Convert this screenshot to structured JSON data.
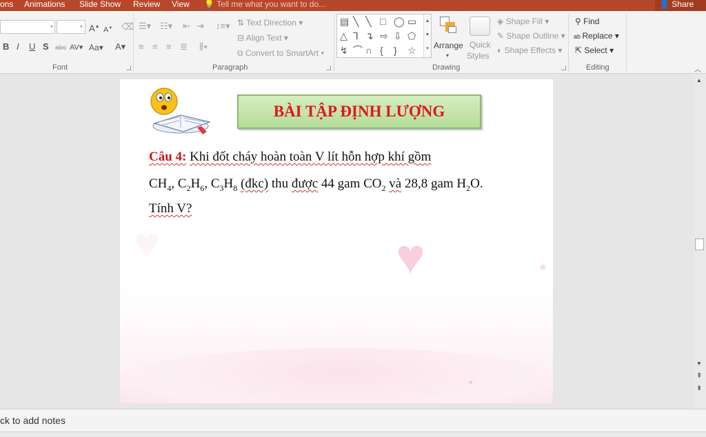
{
  "tabs": {
    "transitions": "ons",
    "animations": "Animations",
    "slide_show": "Slide Show",
    "review": "Review",
    "view": "View",
    "tell_me": "Tell me what you want to do...",
    "share": "Share"
  },
  "ribbon": {
    "font": {
      "label": "Font",
      "grow": "A",
      "shrink": "A",
      "bold": "B",
      "italic": "I",
      "underline": "U",
      "shadow": "S",
      "strike": "abc",
      "spacing": "AV",
      "change_case": "Aa",
      "color": "A"
    },
    "paragraph": {
      "label": "Paragraph",
      "text_direction": "Text Direction",
      "align_text": "Align Text",
      "convert_smartart": "Convert to SmartArt"
    },
    "drawing": {
      "label": "Drawing",
      "arrange": "Arrange",
      "quick_styles_1": "Quick",
      "quick_styles_2": "Styles",
      "shape_fill": "Shape Fill",
      "shape_outline": "Shape Outline",
      "shape_effects": "Shape Effects",
      "shape_glyphs": [
        "▤",
        "╲",
        "╲",
        "□",
        "◯",
        "▭",
        "△",
        "⅂",
        "↴",
        "⇨",
        "⇩",
        "⬠",
        "↯",
        "⌒",
        "∩",
        "{",
        "}",
        "☆"
      ]
    },
    "editing": {
      "label": "Editing",
      "find": "Find",
      "replace": "Replace",
      "select": "Select"
    }
  },
  "slide": {
    "title": "BÀI TẬP ĐỊNH LƯỢNG",
    "question_label": "Câu 4:",
    "line1": "Khi đốt cháy hoàn toàn V lít hỗn hợp khí gồm",
    "line3": "Tính V?",
    "line2": {
      "ch": "CH",
      "ch_sub": "4",
      "sep1": ", C",
      "c2_sub": "2",
      "h_a": "H",
      "h6_sub": "6",
      "sep2": ", C",
      "c3_sub": "3",
      "h_b": "H",
      "h8_sub": "8",
      "dkc": "(đkc)",
      "mid1": "thu",
      "mid2": "được",
      "mid3": "44 gam CO",
      "co2_sub": "2",
      "va": "và",
      "rest": "28,8 gam H",
      "h2_sub": "2",
      "end": "O."
    }
  },
  "notes": {
    "placeholder": "ck to add notes"
  },
  "colors": {
    "accent": "#b7472a",
    "title_red": "#e0161f",
    "title_green": "#c4e5ab"
  }
}
